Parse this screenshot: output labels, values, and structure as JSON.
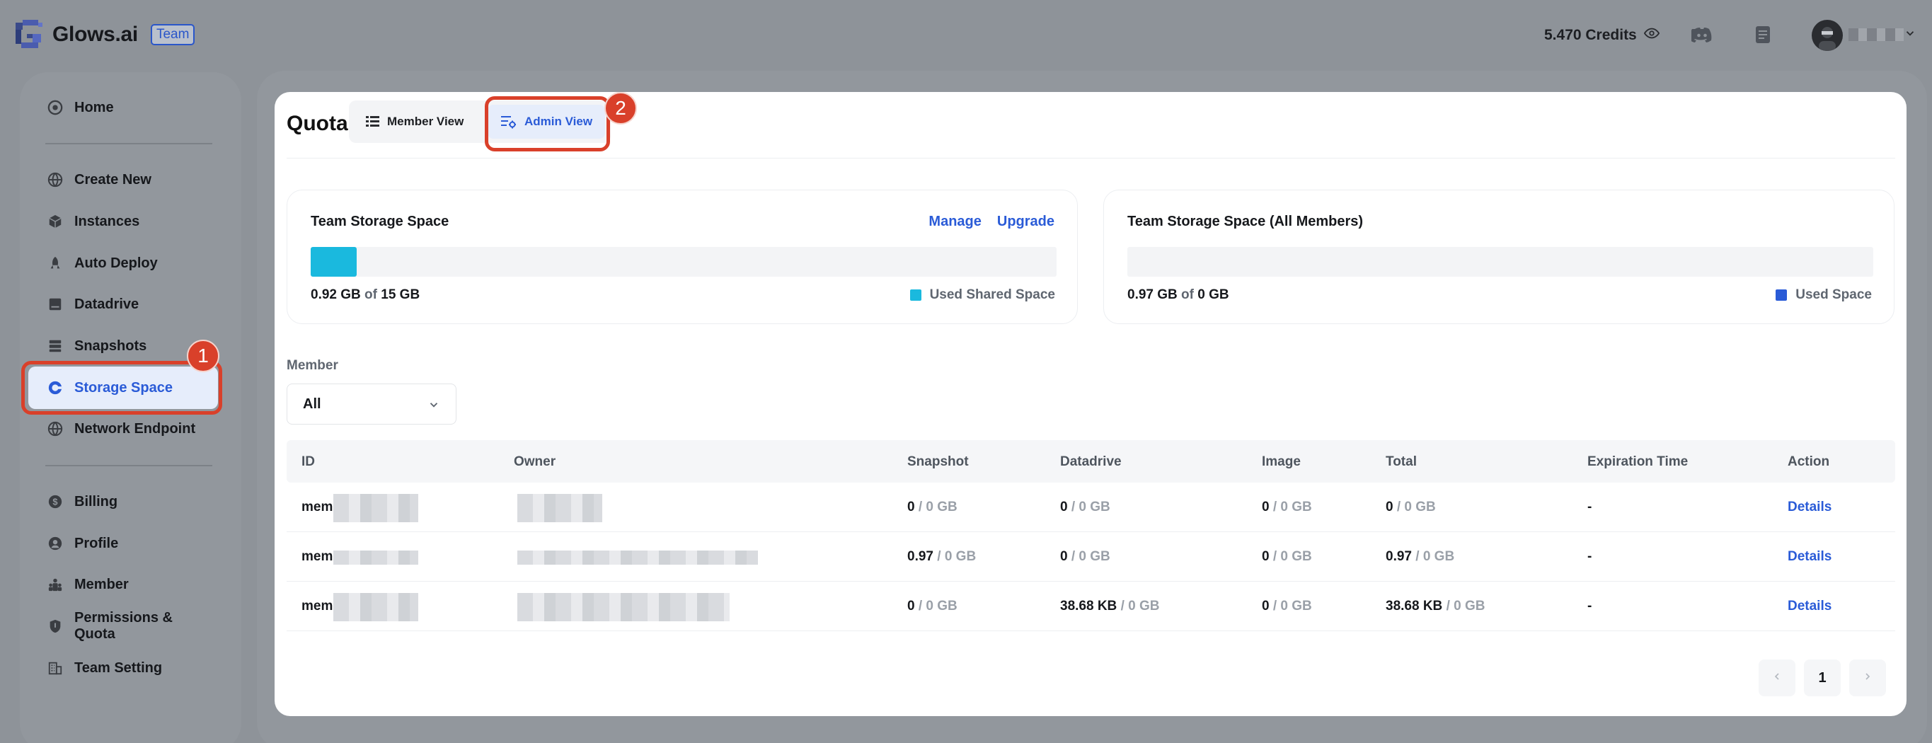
{
  "header": {
    "logo_text": "Glows.ai",
    "team_badge": "Team",
    "credits": "5.470 Credits",
    "icons": [
      "eye-icon",
      "discord-icon",
      "document-icon",
      "chevron-down-icon"
    ]
  },
  "sidebar": {
    "items": [
      {
        "label": "Home",
        "icon": "home-icon"
      },
      {
        "label": "Create New",
        "icon": "globe-icon"
      },
      {
        "label": "Instances",
        "icon": "cube-icon"
      },
      {
        "label": "Auto Deploy",
        "icon": "rocket-icon"
      },
      {
        "label": "Datadrive",
        "icon": "drive-icon"
      },
      {
        "label": "Snapshots",
        "icon": "layers-icon"
      },
      {
        "label": "Storage Space",
        "icon": "storage-icon",
        "active": true
      },
      {
        "label": "Network Endpoint",
        "icon": "network-icon"
      },
      {
        "label": "Billing",
        "icon": "dollar-icon"
      },
      {
        "label": "Profile",
        "icon": "user-icon"
      },
      {
        "label": "Member",
        "icon": "members-icon"
      },
      {
        "label": "Permissions & Quota",
        "icon": "shield-icon"
      },
      {
        "label": "Team Setting",
        "icon": "building-icon"
      }
    ]
  },
  "annotations": {
    "badge1": "1",
    "badge2": "2",
    "color": "#d9402a"
  },
  "main": {
    "title": "Quota",
    "views": {
      "member": "Member View",
      "admin": "Admin View",
      "selected": "admin"
    },
    "cards": {
      "team": {
        "title": "Team Storage Space",
        "manage": "Manage",
        "upgrade": "Upgrade",
        "used": "0.92 GB",
        "of": "of",
        "total": "15 GB",
        "fill_fraction": 0.0613,
        "legend": "Used Shared Space",
        "color": "#1ab9de"
      },
      "members": {
        "title": "Team Storage Space (All Members)",
        "used": "0.97 GB",
        "of": "of",
        "total": "0 GB",
        "legend": "Used Space",
        "color": "#2a5bd7"
      }
    },
    "filter": {
      "label": "Member",
      "value": "All"
    },
    "table": {
      "headers": [
        "ID",
        "Owner",
        "Snapshot",
        "Datadrive",
        "Image",
        "Total",
        "Expiration Time",
        "Action"
      ],
      "rows": [
        {
          "id": "mem",
          "snapshot": "0",
          "datadrive": "0",
          "image": "0",
          "total": "0",
          "expiration": "-",
          "action": "Details"
        },
        {
          "id": "mem",
          "snapshot": "0.97",
          "datadrive": "0",
          "image": "0",
          "total": "0.97",
          "expiration": "-",
          "action": "Details"
        },
        {
          "id": "mem",
          "snapshot": "0",
          "datadrive": "38.68 KB",
          "image": "0",
          "total": "38.68 KB",
          "expiration": "-",
          "action": "Details"
        }
      ],
      "quota_suffix": "/ 0 GB"
    },
    "pagination": {
      "current": "1"
    }
  }
}
